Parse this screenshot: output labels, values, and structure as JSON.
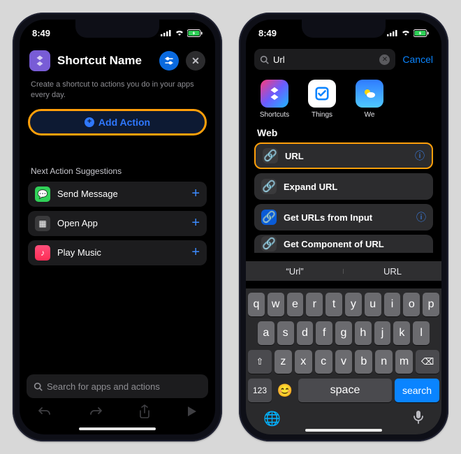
{
  "status": {
    "time": "8:49"
  },
  "phoneA": {
    "title": "Shortcut Name",
    "intro": "Create a shortcut to actions you do in your apps every day.",
    "add_action": "Add Action",
    "suggestions_label": "Next Action Suggestions",
    "suggestions": [
      {
        "label": "Send Message",
        "color": "#30d158"
      },
      {
        "label": "Open App",
        "color": "#4a4a4e"
      },
      {
        "label": "Play Music",
        "color": "#ff375f"
      }
    ],
    "search_placeholder": "Search for apps and actions"
  },
  "phoneB": {
    "search_query": "Url",
    "cancel": "Cancel",
    "apps": [
      {
        "label": "Shortcuts",
        "color": "linear-gradient(135deg,#ff3b7b,#6a5cff,#1fb6ff)"
      },
      {
        "label": "Things",
        "color": "#ffffff"
      },
      {
        "label": "We",
        "color": "linear-gradient(180deg,#2f7bff,#4fc9ff)"
      }
    ],
    "group_label": "Web",
    "actions": [
      {
        "label": "URL",
        "highlight": true,
        "info": true
      },
      {
        "label": "Expand URL",
        "highlight": false,
        "info": false
      },
      {
        "label": "Get URLs from Input",
        "highlight": false,
        "info": true
      },
      {
        "label": "Get Component of URL",
        "highlight": false,
        "info": false
      }
    ],
    "quicktype": [
      "“Url”",
      "URL"
    ],
    "keyboard": {
      "row1": [
        "q",
        "w",
        "e",
        "r",
        "t",
        "y",
        "u",
        "i",
        "o",
        "p"
      ],
      "row2": [
        "a",
        "s",
        "d",
        "f",
        "g",
        "h",
        "j",
        "k",
        "l"
      ],
      "row3": [
        "z",
        "x",
        "c",
        "v",
        "b",
        "n",
        "m"
      ],
      "num": "123",
      "space": "space",
      "search": "search"
    }
  }
}
